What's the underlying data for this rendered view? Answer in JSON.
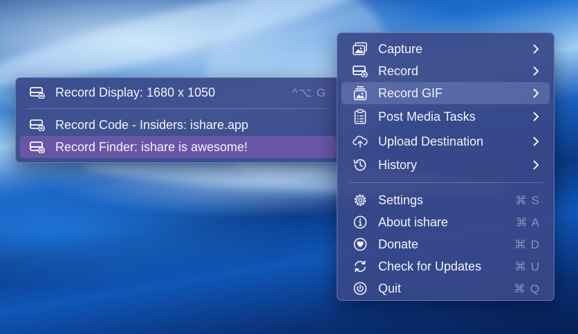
{
  "main_menu": {
    "items": [
      {
        "label": "Capture",
        "icon": "image-stack-icon",
        "has_submenu": true
      },
      {
        "label": "Record",
        "icon": "record-display-icon",
        "has_submenu": true
      },
      {
        "label": "Record GIF",
        "icon": "gif-photo-icon",
        "has_submenu": true,
        "highlighted": true
      },
      {
        "label": "Post Media Tasks",
        "icon": "clipboard-list-icon",
        "has_submenu": true
      },
      {
        "label": "Upload Destination",
        "icon": "cloud-upload-icon",
        "has_submenu": true
      },
      {
        "label": "History",
        "icon": "history-clock-icon",
        "has_submenu": true
      }
    ],
    "secondary_items": [
      {
        "label": "Settings",
        "icon": "gear-icon",
        "shortcut": "⌘ S"
      },
      {
        "label": "About ishare",
        "icon": "info-icon",
        "shortcut": "⌘ A"
      },
      {
        "label": "Donate",
        "icon": "heart-icon",
        "shortcut": "⌘ D"
      },
      {
        "label": "Check for Updates",
        "icon": "refresh-icon",
        "shortcut": "⌘ U"
      },
      {
        "label": "Quit",
        "icon": "power-icon",
        "shortcut": "⌘ Q"
      }
    ]
  },
  "sub_menu": {
    "header_item": {
      "label": "Record Display: 1680 x 1050",
      "icon": "record-display-icon",
      "shortcut": "^⌥ G"
    },
    "items": [
      {
        "label": "Record Code - Insiders: ishare.app",
        "icon": "record-display-icon"
      },
      {
        "label": "Record Finder: ishare is awesome!",
        "icon": "record-display-icon",
        "selected": true
      }
    ]
  },
  "colors": {
    "menu_bg": "#3a4888",
    "selected_bg": "#6a56a6",
    "text": "#f1f3fb",
    "shortcut_text": "#c8cee6"
  }
}
